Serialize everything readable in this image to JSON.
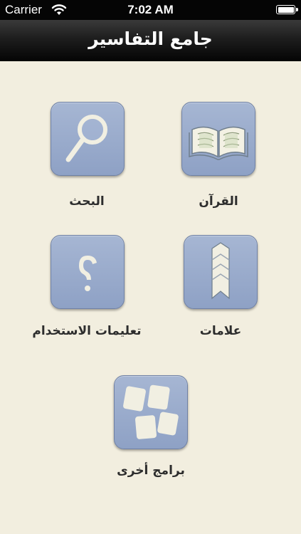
{
  "status_bar": {
    "carrier": "Carrier",
    "time": "7:02 AM",
    "wifi_icon": "wifi-icon",
    "battery_icon": "battery-icon"
  },
  "nav": {
    "title": "جامع التفاسير"
  },
  "menu": {
    "quran": {
      "label": "القرآن",
      "icon": "open-book-icon"
    },
    "search": {
      "label": "البحث",
      "icon": "magnifier-icon"
    },
    "bookmarks": {
      "label": "علامات",
      "icon": "bookmark-ribbon-icon"
    },
    "help": {
      "label": "تعليمات الاستخدام",
      "icon": "question-mark-icon"
    },
    "other_apps": {
      "label": "برامج أخرى",
      "icon": "app-cards-icon"
    }
  },
  "colors": {
    "background": "#f2eedf",
    "tile": "#97a9cb",
    "nav_bar": "#1a1a1a",
    "label_text": "#2d2d2d"
  }
}
